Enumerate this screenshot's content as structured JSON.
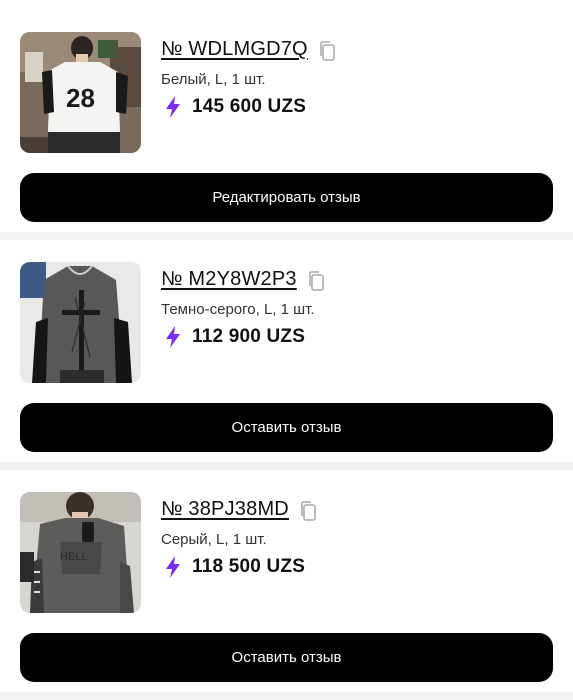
{
  "orders": [
    {
      "order_number": "№ WDLMGD7Q",
      "variant": "Белый, L, 1 шт.",
      "price": "145 600 UZS",
      "button_label": "Редактировать отзыв"
    },
    {
      "order_number": "№ M2Y8W2P3",
      "variant": "Темно-серого, L, 1 шт.",
      "price": "112 900 UZS",
      "button_label": "Оставить отзыв"
    },
    {
      "order_number": "№ 38PJ38MD",
      "variant": "Серый, L, 1 шт.",
      "price": "118 500 UZS",
      "button_label": "Оставить отзыв"
    }
  ],
  "colors": {
    "accent_bolt": "#7b2cf5",
    "button_bg": "#000000",
    "page_bg": "#f2f2f4"
  },
  "icons": {
    "copy": "copy-icon",
    "bolt": "lightning-bolt-icon"
  }
}
